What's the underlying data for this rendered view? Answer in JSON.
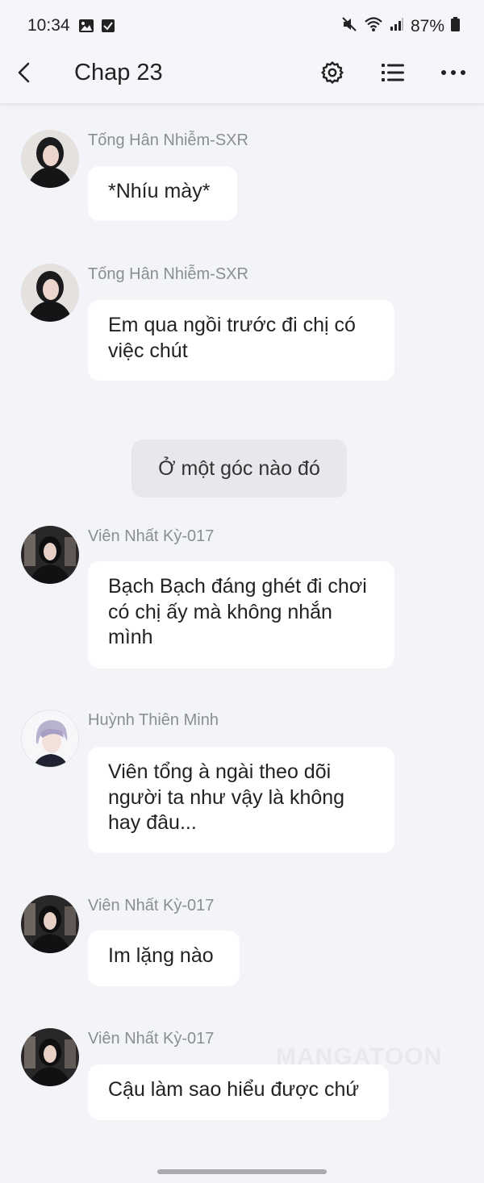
{
  "status_bar": {
    "time": "10:34",
    "battery": "87%"
  },
  "header": {
    "title": "Chap 23"
  },
  "messages": [
    {
      "sender": "Tống Hân Nhiễm-SXR",
      "text": "*Nhíu mày*"
    },
    {
      "sender": "Tống Hân Nhiễm-SXR",
      "text": "Em qua ngồi trước đi chị có việc chút"
    },
    {
      "sender": "Viên Nhất Kỳ-017",
      "text": "Bạch Bạch đáng ghét đi chơi có chị ấy mà không nhắn mình"
    },
    {
      "sender": "Huỳnh Thiên Minh",
      "text": "Viên tổng à ngài theo dõi người ta như vậy là không hay đâu..."
    },
    {
      "sender": "Viên Nhất Kỳ-017",
      "text": "Im lặng nào"
    },
    {
      "sender": "Viên Nhất Kỳ-017",
      "text": "Cậu làm sao hiểu được chứ"
    }
  ],
  "narration": {
    "text": "Ở một góc nào đó"
  },
  "watermark": "MANGATOON",
  "icons": {
    "back": "back-arrow-icon",
    "settings": "gear-icon",
    "list": "list-icon",
    "more": "more-dots-icon"
  }
}
